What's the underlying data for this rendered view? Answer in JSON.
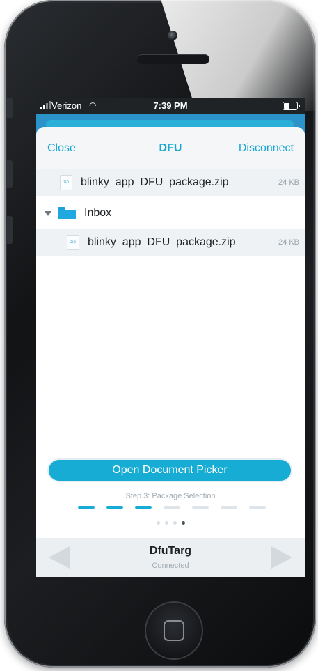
{
  "status_bar": {
    "carrier": "Verizon",
    "time": "7:39 PM"
  },
  "nav": {
    "close": "Close",
    "title": "DFU",
    "disconnect": "Disconnect"
  },
  "files": [
    {
      "name": "blinky_app_DFU_package.zip",
      "size": "24 KB",
      "icon_label": "zip"
    },
    {
      "folder": "Inbox"
    },
    {
      "name": "blinky_app_DFU_package.zip",
      "size": "24 KB",
      "icon_label": "zip"
    }
  ],
  "picker_button": "Open Document Picker",
  "step": {
    "label": "Step 3: Package Selection",
    "current": 3,
    "total": 7
  },
  "page_dots": {
    "current": 4,
    "total": 4
  },
  "device": {
    "name": "DfuTarg",
    "status": "Connected"
  },
  "colors": {
    "accent": "#17acd3",
    "status_bar": "#1f2326"
  }
}
